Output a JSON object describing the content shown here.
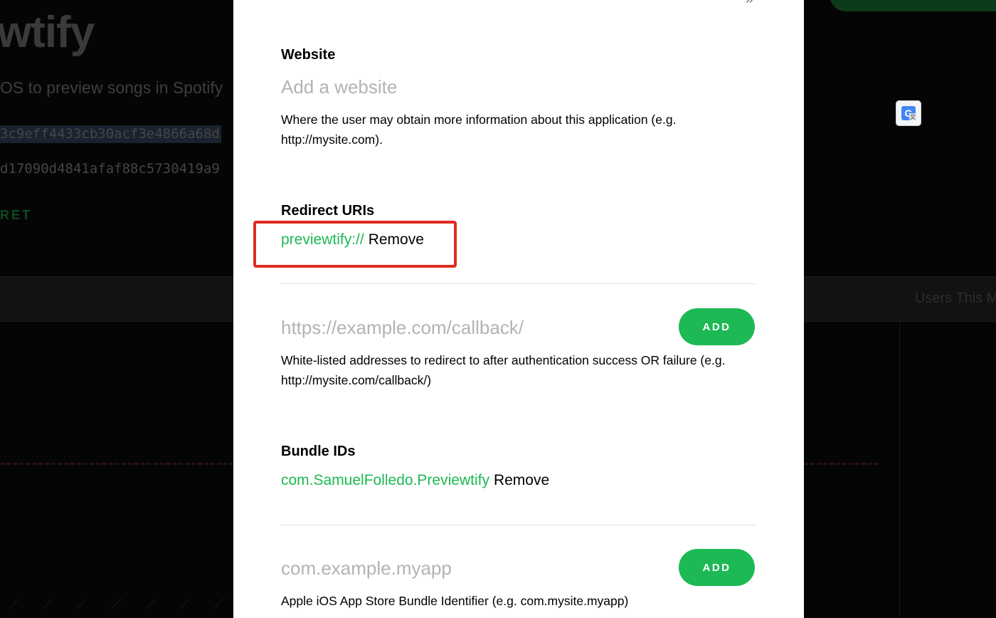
{
  "background": {
    "app_title": "wtify",
    "app_description": "OS to preview songs in Spotify",
    "client_id": "3c9eff4433cb30acf3e4866a68d",
    "client_secret": "d17090d4841afaf88c5730419a9",
    "secret_label": "RET",
    "users_label": "Users This M",
    "accent_color": "#1db954"
  },
  "modal": {
    "website": {
      "title": "Website",
      "placeholder": "Add a website",
      "help": "Where the user may obtain more information about this application (e.g. http://mysite.com)."
    },
    "redirect_uris": {
      "title": "Redirect URIs",
      "items": [
        {
          "value": "previewtify://",
          "remove_label": "Remove"
        }
      ],
      "placeholder": "https://example.com/callback/",
      "add_label": "ADD",
      "help": "White-listed addresses to redirect to after authentication success OR failure (e.g. http://mysite.com/callback/)"
    },
    "bundle_ids": {
      "title": "Bundle IDs",
      "items": [
        {
          "value": "com.SamuelFolledo.Previewtify",
          "remove_label": "Remove"
        }
      ],
      "placeholder": "com.example.myapp",
      "add_label": "ADD",
      "help": "Apple iOS App Store Bundle Identifier (e.g. com.mysite.myapp)"
    }
  }
}
